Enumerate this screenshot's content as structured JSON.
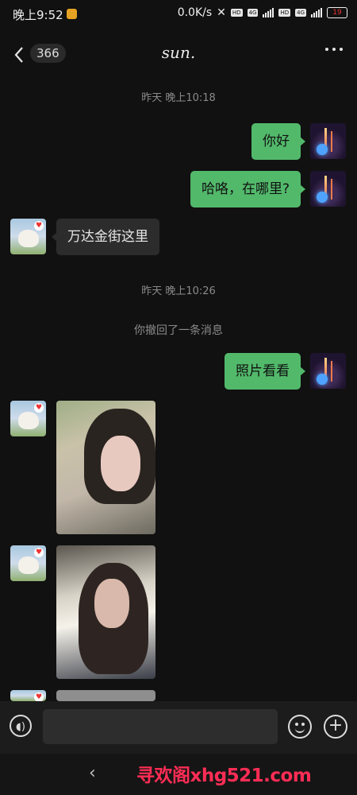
{
  "status_bar": {
    "time": "晚上9:52",
    "net_speed": "0.0K/s",
    "hd1": "HD",
    "hd2": "HD",
    "net1": "4G",
    "net2": "4G",
    "battery": "19"
  },
  "header": {
    "back_count": "366",
    "contact_name": "sun."
  },
  "messages": {
    "ts1": "昨天 晚上10:18",
    "m1": "你好",
    "m2": "哈咯，在哪里?",
    "m3": "万达金街这里",
    "ts2": "昨天 晚上10:26",
    "recall": "你撤回了一条消息",
    "m4": "照片看看"
  },
  "input": {
    "placeholder": ""
  },
  "nav": {
    "back": "‹",
    "watermark": "寻欢阁xhg521.com"
  },
  "colors": {
    "my_bubble": "#52b96b",
    "their_bubble": "#2c2c2c",
    "background": "#111111",
    "watermark": "#ff2d55"
  }
}
